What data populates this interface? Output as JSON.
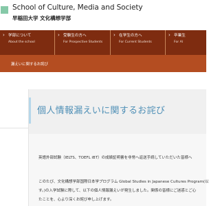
{
  "header": {
    "title": "School of Culture, Media and Society",
    "subtitle": "早稲田大学 文化構想学部"
  },
  "nav": {
    "items": [
      {
        "label": "学部について",
        "sub": "About the school"
      },
      {
        "label": "受験生の方へ",
        "sub": "For Prospective Students"
      },
      {
        "label": "在学生の方へ",
        "sub": "For Current Students"
      },
      {
        "label": "卒業生",
        "sub": "For Al"
      }
    ]
  },
  "breadcrumb": {
    "text": "漏えいに関するお詫び"
  },
  "article": {
    "title": "個人情報漏えいに関するお詫び",
    "paragraph1": "英語外部試験（IELTS、TOEFL iBT）の成績証明書を非常へ返送手続していただいた皆様へ",
    "paragraph2_line1": "このたび、文化構想学部国際日本学プログラム Global Studies in Japanese Cultures Program(以",
    "paragraph2_line2": "す。)の入学試験に際して、以下の個人情報漏えいが発生しました。関係の皆様にご迷惑とご心",
    "paragraph2_line3": "たことを、心より深くお詫び申し上げます。"
  },
  "colors": {
    "nav_background": "#7e2c10",
    "breadcrumb_background": "#b44d21",
    "title_color": "#4e8fb6",
    "logo_color": "#86c9a8"
  }
}
